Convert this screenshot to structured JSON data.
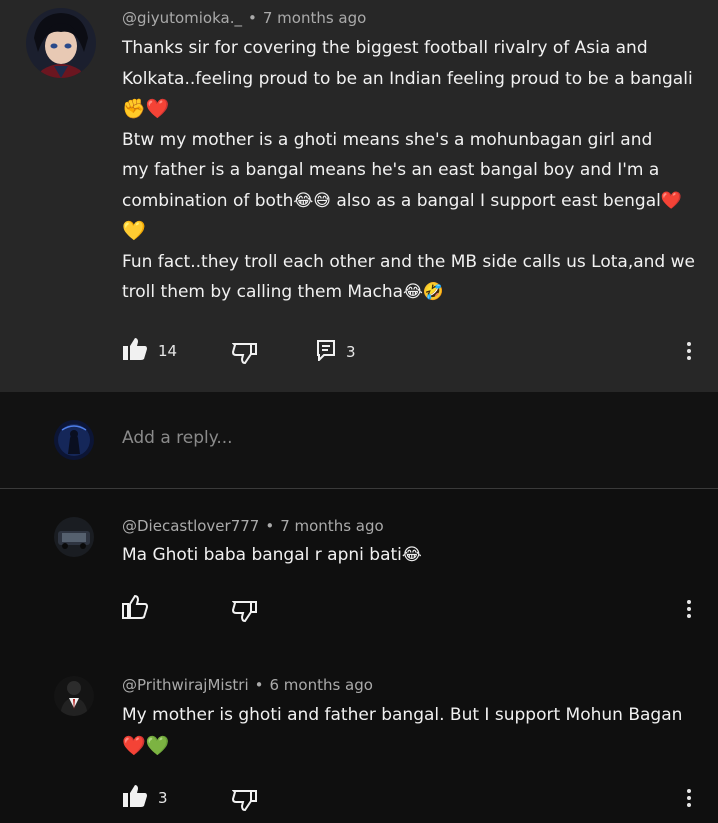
{
  "colors": {
    "parent_bg": "#272727",
    "page_bg": "#0f0f0f",
    "text": "#f1f1f1",
    "meta": "#aaaaaa",
    "heart_red": "#e0243a",
    "heart_green": "#5cc23a",
    "heart_yellow": "#f5c518"
  },
  "parent": {
    "author": "@giyutomioka._",
    "time": "7 months ago",
    "lines": [
      "Thanks sir for covering the biggest football rivalry of Asia and",
      "Kolkata..feeling proud to be an Indian feeling proud to be a bangali",
      "✊❤️",
      "Btw my mother is a ghoti means she's a mohunbagan girl and",
      "my father is a bangal means he's an east bangal boy and I'm a",
      "combination of both😂😅 also as a bangal I support east bengal❤️",
      "💛",
      "Fun fact..they troll each other and the MB side calls us Lota,and we",
      "troll them by calling them Macha😂🤣"
    ],
    "likes": "14",
    "replies": "3",
    "icons": {
      "like": "thumbs-up-filled-icon",
      "dislike": "thumbs-down-icon",
      "reply": "comment-icon",
      "more": "more-vert-icon"
    }
  },
  "reply_box": {
    "placeholder": "Add a reply..."
  },
  "replies": [
    {
      "author": "@Diecastlover777",
      "time": "7 months ago",
      "lines": [
        "Ma Ghoti baba bangal r apni bati😂"
      ],
      "likes": ""
    },
    {
      "author": "@PrithwirajMistri",
      "time": "6 months ago",
      "lines": [
        "My mother is ghoti and father bangal. But I support Mohun Bagan",
        "❤️💚"
      ],
      "likes": "3"
    }
  ]
}
